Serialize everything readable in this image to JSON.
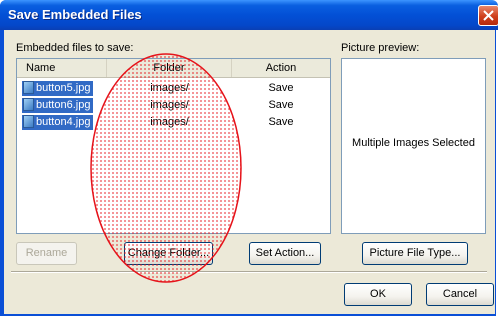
{
  "window": {
    "title": "Save Embedded Files"
  },
  "labels": {
    "files_to_save": "Embedded files to save:",
    "preview": "Picture preview:"
  },
  "table": {
    "columns": [
      "Name",
      "Folder",
      "Action"
    ],
    "rows": [
      {
        "name": "button5.jpg",
        "folder": "images/",
        "action": "Save"
      },
      {
        "name": "button6.jpg",
        "folder": "images/",
        "action": "Save"
      },
      {
        "name": "button4.jpg",
        "folder": "images/",
        "action": "Save"
      }
    ]
  },
  "preview": {
    "text": "Multiple Images Selected"
  },
  "buttons": {
    "rename": "Rename",
    "change_folder": "Change Folder...",
    "set_action": "Set Action...",
    "picture_file_type": "Picture File Type...",
    "ok": "OK",
    "cancel": "Cancel"
  },
  "colors": {
    "title_bar": "#0a5fe0",
    "selection": "#316ac5",
    "highlight": "#e6131a"
  },
  "icons": {
    "close": "close-icon",
    "file": "image-file-icon"
  }
}
